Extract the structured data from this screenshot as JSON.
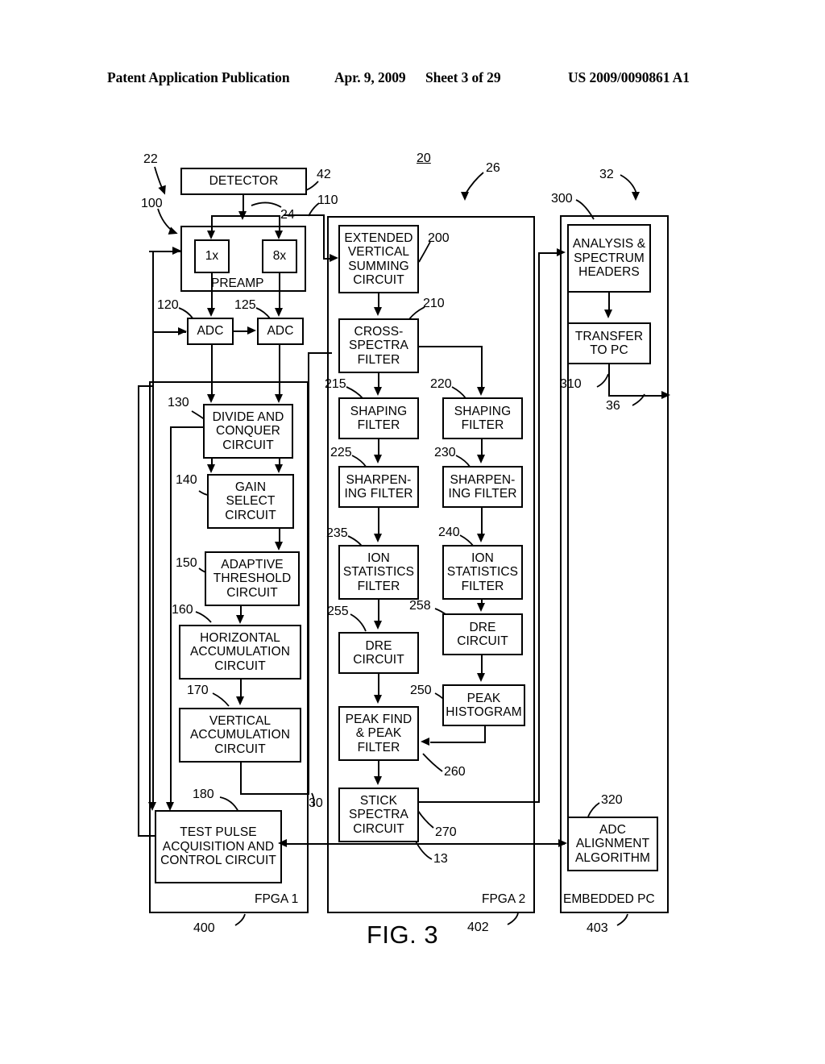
{
  "publication_header": {
    "publication": "Patent Application Publication",
    "date": "Apr. 9, 2009",
    "sheet": "Sheet 3 of 29",
    "number": "US 2009/0090861 A1"
  },
  "figure": {
    "caption": "FIG. 3"
  },
  "containers": [
    {
      "id": "fpga1",
      "label": "FPGA 1",
      "ref": "400"
    },
    {
      "id": "fpga2",
      "label": "FPGA 2",
      "ref": "402"
    },
    {
      "id": "epc",
      "label": "EMBEDDED PC",
      "ref": "403"
    },
    {
      "id": "preamp",
      "label": "PREAMP",
      "ref": "24"
    }
  ],
  "blocks": {
    "detector": {
      "label": "DETECTOR",
      "ref": "42"
    },
    "gain_1x": {
      "label": "1x",
      "ref": ""
    },
    "gain_8x": {
      "label": "8x",
      "ref": ""
    },
    "adc_1": {
      "label": "ADC",
      "ref": "120"
    },
    "adc_2": {
      "label": "ADC",
      "ref": "125"
    },
    "divide_conquer": {
      "label": "DIVIDE AND CONQUER CIRCUIT",
      "ref": "130"
    },
    "gain_select": {
      "label": "GAIN SELECT CIRCUIT",
      "ref": "140"
    },
    "adaptive_thresh": {
      "label": "ADAPTIVE THRESHOLD CIRCUIT",
      "ref": "150"
    },
    "horiz_accum": {
      "label": "HORIZONTAL ACCUMULATION CIRCUIT",
      "ref": "160"
    },
    "vert_accum": {
      "label": "VERTICAL ACCUMULATION CIRCUIT",
      "ref": "170"
    },
    "test_pulse": {
      "label": "TEST PULSE ACQUISITION AND CONTROL CIRCUIT",
      "ref": "180"
    },
    "ext_vert_sum": {
      "label": "EXTENDED VERTICAL SUMMING CIRCUIT",
      "ref": "200"
    },
    "cross_spectra": {
      "label": "CROSS- SPECTRA FILTER",
      "ref": "210"
    },
    "shaping_left": {
      "label": "SHAPING FILTER",
      "ref": "215"
    },
    "shaping_right": {
      "label": "SHAPING FILTER",
      "ref": "220"
    },
    "sharpen_left": {
      "label": "SHARPEN- ING FILTER",
      "ref": "225"
    },
    "sharpen_right": {
      "label": "SHARPEN- ING FILTER",
      "ref": "230"
    },
    "ion_stats_left": {
      "label": "ION STATISTICS FILTER",
      "ref": "235"
    },
    "ion_stats_right": {
      "label": "ION STATISTICS FILTER",
      "ref": "240"
    },
    "dre_left": {
      "label": "DRE CIRCUIT",
      "ref": "255"
    },
    "dre_right": {
      "label": "DRE CIRCUIT",
      "ref": "258"
    },
    "peak_histogram": {
      "label": "PEAK HISTOGRAM",
      "ref": "250"
    },
    "peak_find": {
      "label": "PEAK FIND & PEAK FILTER",
      "ref": "260"
    },
    "stick_spectra": {
      "label": "STICK SPECTRA CIRCUIT",
      "ref": "270"
    },
    "analysis": {
      "label": "ANALYSIS & SPECTRUM HEADERS",
      "ref": "300"
    },
    "transfer_pc": {
      "label": "TRANSFER TO PC",
      "ref": "310"
    },
    "adc_alignment": {
      "label": "ADC ALIGNMENT ALGORITHM",
      "ref": "320"
    }
  },
  "reference_numerals": {
    "n22": "22",
    "n100": "100",
    "n42": "42",
    "n24": "24",
    "n110": "110",
    "n20": "20",
    "n26": "26",
    "n32": "32",
    "n300": "300",
    "n200": "200",
    "n210": "210",
    "n120": "120",
    "n125": "125",
    "n215": "215",
    "n220": "220",
    "n310": "310",
    "n36": "36",
    "n130": "130",
    "n225": "225",
    "n230": "230",
    "n140": "140",
    "n150": "150",
    "n235": "235",
    "n240": "240",
    "n160": "160",
    "n255": "255",
    "n258": "258",
    "n170": "170",
    "n250": "250",
    "n180": "180",
    "n30": "30",
    "n260": "260",
    "n270": "270",
    "n13": "13",
    "n320": "320",
    "n400": "400",
    "n402": "402",
    "n403": "403"
  },
  "colors": {
    "ink": "#000000",
    "paper": "#ffffff"
  }
}
